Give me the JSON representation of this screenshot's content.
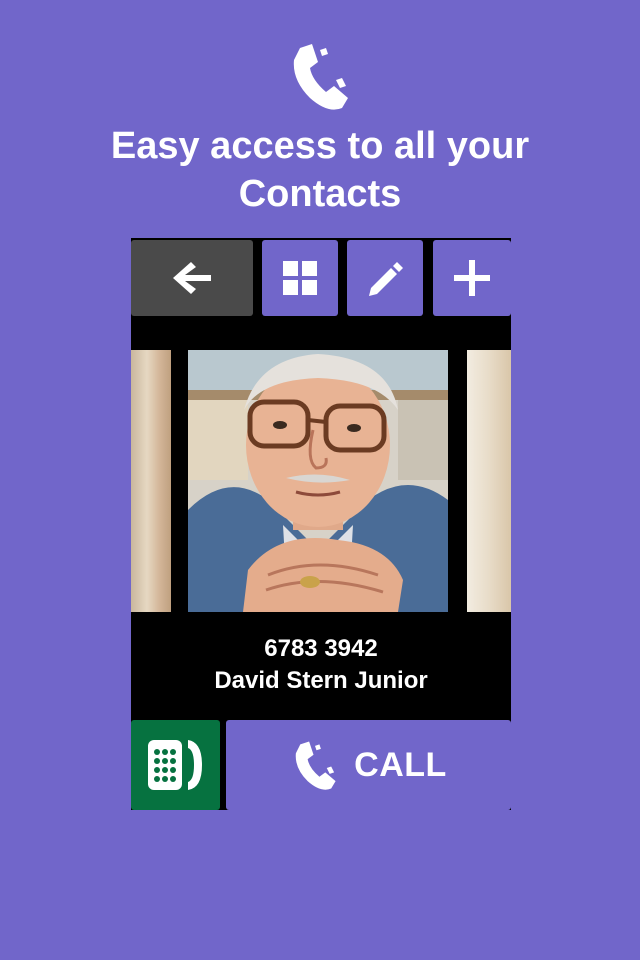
{
  "headline": {
    "line1": "Easy access to all your",
    "line2": "Contacts"
  },
  "toolbar": {
    "back_icon": "arrow-left-icon",
    "grid_icon": "grid-icon",
    "edit_icon": "pencil-icon",
    "add_icon": "plus-icon"
  },
  "contact": {
    "number": "6783 3942",
    "name": "David Stern Junior"
  },
  "actions": {
    "keypad_icon": "keypad-phone-icon",
    "call_icon": "phone-icon",
    "call_label": "CALL"
  },
  "colors": {
    "background": "#7166CA",
    "back_button": "#4A4A4A",
    "keypad_button": "#067240",
    "device_frame": "#000000"
  }
}
